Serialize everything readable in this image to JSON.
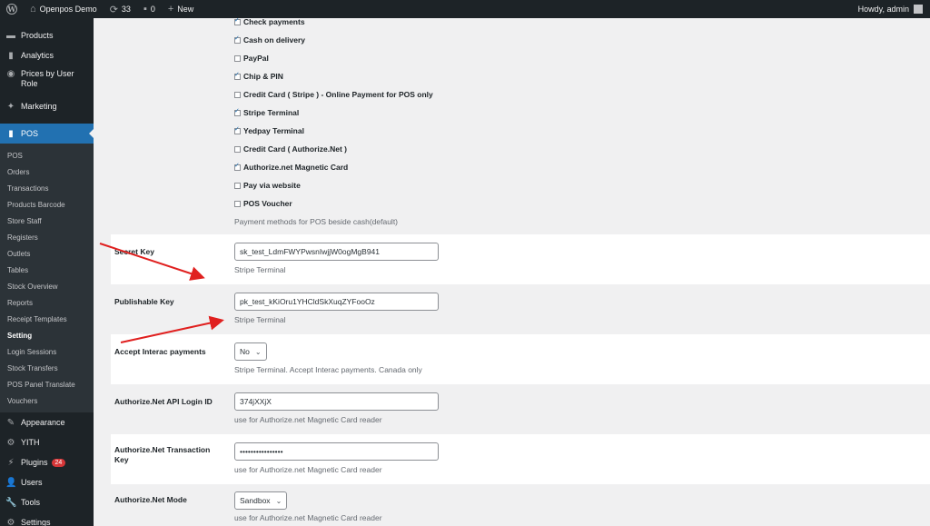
{
  "adminbar": {
    "site_name": "Openpos Demo",
    "updates_count": "33",
    "comments_count": "0",
    "new_label": "New",
    "howdy": "Howdy, admin"
  },
  "sidebar": {
    "top_items": [
      {
        "label": "Products",
        "icon": "products-icon"
      },
      {
        "label": "Analytics",
        "icon": "analytics-icon"
      },
      {
        "label": "Prices by User Role",
        "icon": "prices-icon"
      },
      {
        "label": "Marketing",
        "icon": "marketing-icon"
      }
    ],
    "pos_label": "POS",
    "pos_sub": [
      "POS",
      "Orders",
      "Transactions",
      "Products Barcode",
      "Store Staff",
      "Registers",
      "Outlets",
      "Tables",
      "Stock Overview",
      "Reports",
      "Receipt Templates",
      "Setting",
      "Login Sessions",
      "Stock Transfers",
      "POS Panel Translate",
      "Vouchers"
    ],
    "bottom_items": [
      {
        "label": "Appearance",
        "icon": "appearance-icon"
      },
      {
        "label": "YITH",
        "icon": "yith-icon"
      },
      {
        "label": "Plugins",
        "icon": "plugins-icon",
        "badge": "24"
      },
      {
        "label": "Users",
        "icon": "users-icon"
      },
      {
        "label": "Tools",
        "icon": "tools-icon"
      },
      {
        "label": "Settings",
        "icon": "settings-icon"
      }
    ]
  },
  "payment_methods": [
    {
      "label": "Check payments",
      "checked": true
    },
    {
      "label": "Cash on delivery",
      "checked": true
    },
    {
      "label": "PayPal",
      "checked": false
    },
    {
      "label": "Chip & PIN",
      "checked": true
    },
    {
      "label": "Credit Card ( Stripe ) - Online Payment for POS only",
      "checked": false
    },
    {
      "label": "Stripe Terminal",
      "checked": true
    },
    {
      "label": "Yedpay Terminal",
      "checked": true
    },
    {
      "label": "Credit Card ( Authorize.Net )",
      "checked": false
    },
    {
      "label": "Authorize.net Magnetic Card",
      "checked": true
    },
    {
      "label": "Pay via website",
      "checked": false
    },
    {
      "label": "POS Voucher",
      "checked": false
    }
  ],
  "payment_methods_desc": "Payment methods for POS beside cash(default)",
  "fields": {
    "secret_key": {
      "label": "Secret Key",
      "value": "sk_test_LdmFWYPwsnIwjjW0ogMgB941",
      "desc": "Stripe Terminal"
    },
    "publishable_key": {
      "label": "Publishable Key",
      "value": "pk_test_kKiOru1YHCldSkXuqZYFooOz",
      "desc": "Stripe Terminal"
    },
    "accept_interac": {
      "label": "Accept Interac payments",
      "value": "No",
      "desc": "Stripe Terminal. Accept Interac payments. Canada only"
    },
    "authnet_login": {
      "label": "Authorize.Net API Login ID",
      "value": "374jXXjX",
      "desc": "use for Authorize.net Magnetic Card reader"
    },
    "authnet_key": {
      "label": "Authorize.Net Transaction Key",
      "value": "••••••••••••••••",
      "desc": "use for Authorize.net Magnetic Card reader"
    },
    "authnet_mode": {
      "label": "Authorize.Net Mode",
      "value": "Sandbox",
      "desc": "use for Authorize.net Magnetic Card reader"
    }
  },
  "colors": {
    "accent": "#2271b1",
    "annotation_arrow": "#e0201f",
    "admin_dark": "#1d2327"
  }
}
